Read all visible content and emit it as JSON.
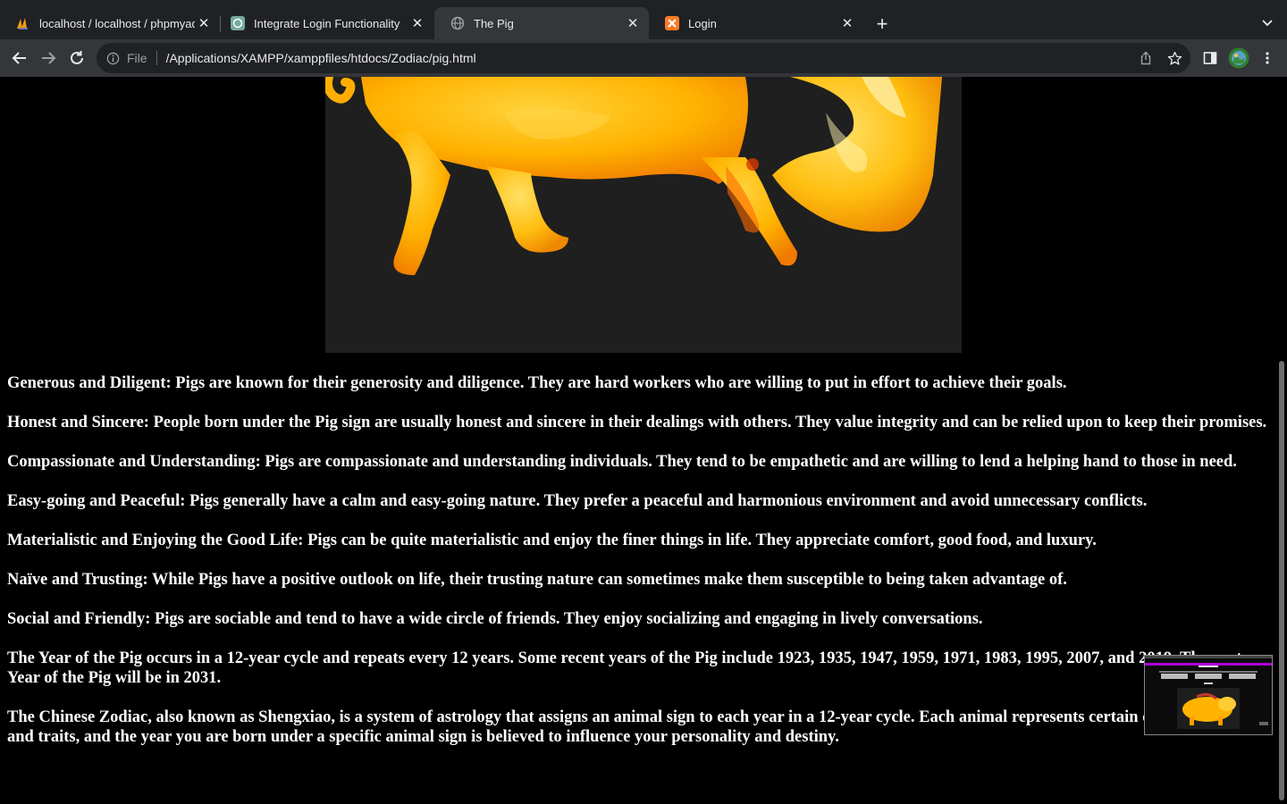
{
  "tabs": [
    {
      "title": "localhost / localhost / phpmyad",
      "icon": "phpmyadmin-icon",
      "active": false
    },
    {
      "title": "Integrate Login Functionality",
      "icon": "chatgpt-icon",
      "active": false
    },
    {
      "title": "The Pig",
      "icon": "globe-icon",
      "active": true
    },
    {
      "title": "Login",
      "icon": "xampp-icon",
      "active": false
    }
  ],
  "toolbar": {
    "scheme": "File",
    "url": "/Applications/XAMPP/xamppfiles/htdocs/Zodiac/pig.html"
  },
  "page": {
    "paragraphs": [
      "Generous and Diligent: Pigs are known for their generosity and diligence. They are hard workers who are willing to put in effort to achieve their goals.",
      "Honest and Sincere: People born under the Pig sign are usually honest and sincere in their dealings with others. They value integrity and can be relied upon to keep their promises.",
      "Compassionate and Understanding: Pigs are compassionate and understanding individuals. They tend to be empathetic and are willing to lend a helping hand to those in need.",
      "Easy-going and Peaceful: Pigs generally have a calm and easy-going nature. They prefer a peaceful and harmonious environment and avoid unnecessary conflicts.",
      "Materialistic and Enjoying the Good Life: Pigs can be quite materialistic and enjoy the finer things in life. They appreciate comfort, good food, and luxury.",
      "Naïve and Trusting: While Pigs have a positive outlook on life, their trusting nature can sometimes make them susceptible to being taken advantage of.",
      "Social and Friendly: Pigs are sociable and tend to have a wide circle of friends. They enjoy socializing and engaging in lively conversations.",
      "The Year of the Pig occurs in a 12-year cycle and repeats every 12 years. Some recent years of the Pig include 1923, 1935, 1947, 1959, 1971, 1983, 1995, 2007, and 2019. The next Year of the Pig will be in 2031.",
      "The Chinese Zodiac, also known as Shengxiao, is a system of astrology that assigns an animal sign to each year in a 12-year cycle. Each animal represents certain characteristics and traits, and the year you are born under a specific animal sign is believed to influence your personality and destiny."
    ]
  },
  "colors": {
    "tab_strip": "#202124",
    "toolbar": "#35363a",
    "page_background": "#000000",
    "text": "#ffffff",
    "pig_gold": "#ffb300"
  }
}
